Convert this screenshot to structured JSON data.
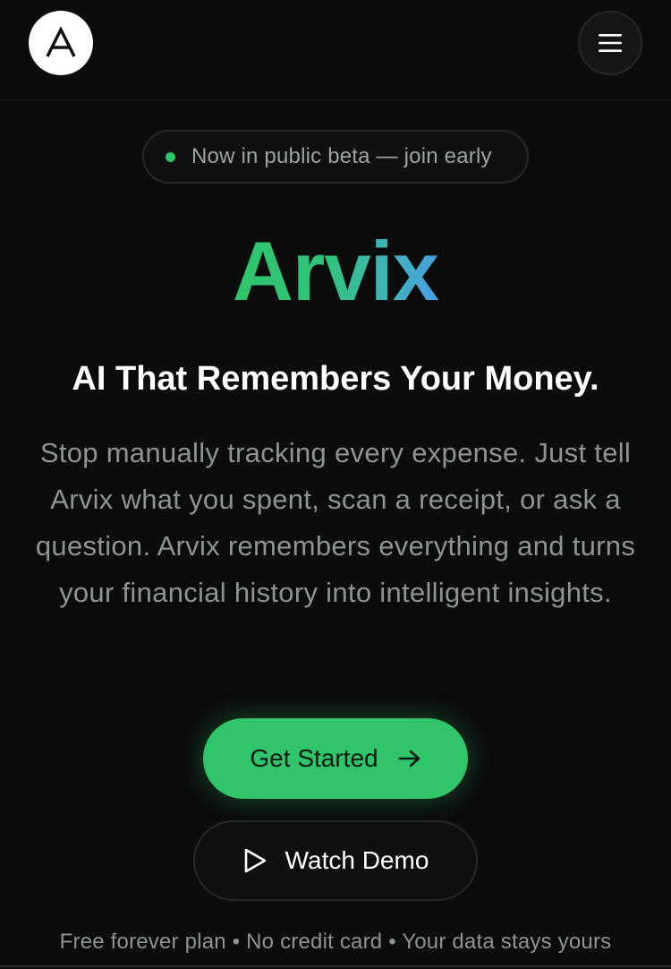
{
  "header": {
    "logo_icon": "logo-a-icon",
    "menu_icon": "hamburger-menu-icon"
  },
  "hero": {
    "badge_text": "Now in public beta — join early",
    "badge_dot_color": "#2fc46a",
    "brand": "Arvix",
    "brand_gradient": [
      "#2fc46a",
      "#4a9fe0"
    ],
    "headline": "AI That Remembers Your Money.",
    "description": "Stop manually tracking every expense. Just tell Arvix what you spent, scan a receipt, or ask a question. Arvix remembers everything and turns your financial history into intelligent insights.",
    "primary_cta": "Get Started",
    "primary_cta_icon": "arrow-right-icon",
    "primary_color": "#31c46b",
    "secondary_cta": "Watch Demo",
    "secondary_cta_icon": "play-icon",
    "footnote": "Free forever plan • No credit card • Your data stays yours"
  }
}
